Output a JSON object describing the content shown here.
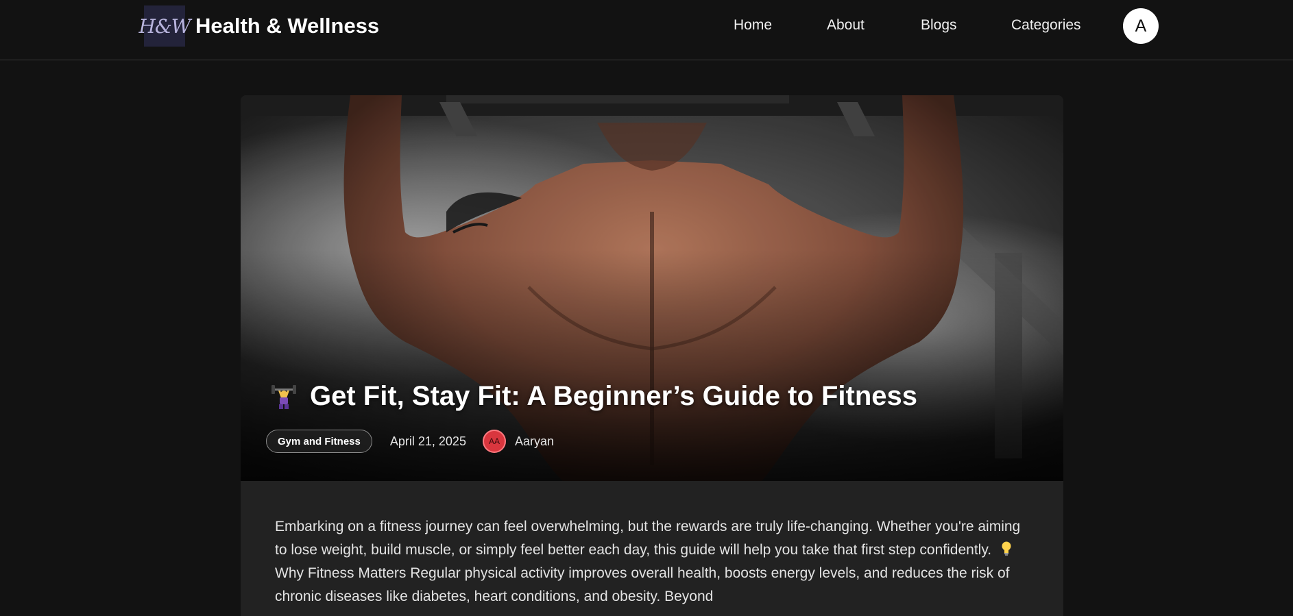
{
  "header": {
    "logo_text": "H&W",
    "site_title": "Health & Wellness",
    "nav": [
      {
        "label": "Home"
      },
      {
        "label": "About"
      },
      {
        "label": "Blogs"
      },
      {
        "label": "Categories"
      }
    ],
    "avatar_initial": "A"
  },
  "post": {
    "title_icon": "weightlifter-emoji-icon",
    "title": "Get Fit, Stay Fit: A Beginner’s Guide to Fitness",
    "category": "Gym and Fitness",
    "date": "April 21, 2025",
    "author_initials": "AA",
    "author_name": "Aaryan",
    "hero_image": "man-doing-pull-ups-back-view",
    "body_part1": "Embarking on a fitness journey can feel overwhelming, but the rewards are truly life-changing. Whether you're aiming to lose weight, build muscle, or simply feel better each day, this guide will help you take that first step confidently.",
    "body_icon": "lightbulb-icon",
    "body_part2": "Why Fitness Matters Regular physical activity improves overall health, boosts energy levels, and reduces the risk of chronic diseases like diabetes, heart conditions, and obesity. Beyond"
  },
  "colors": {
    "background": "#121212",
    "card": "#222222",
    "logo_bg": "#23233a",
    "author_avatar": "#d9363e"
  }
}
